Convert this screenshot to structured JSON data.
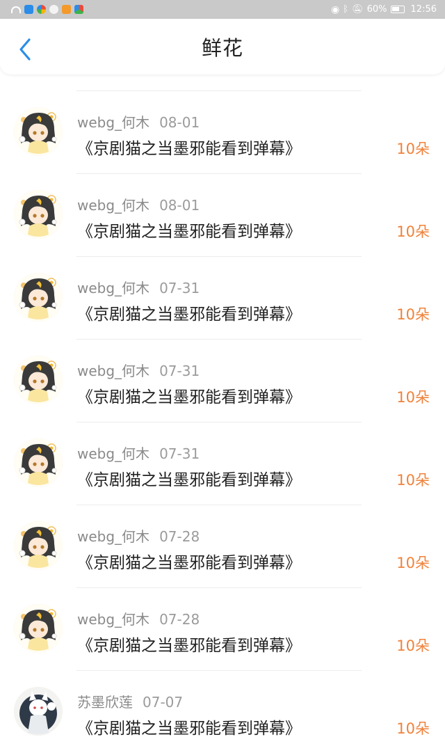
{
  "status_bar": {
    "battery": "60%",
    "time": "12:56"
  },
  "nav": {
    "title": "鲜花"
  },
  "records": [
    {
      "user": "webg_何木",
      "date": "08-01",
      "work": "《京剧猫之当墨邪能看到弹幕》",
      "amount": "10朵",
      "avatar": "girl-avatar"
    },
    {
      "user": "webg_何木",
      "date": "08-01",
      "work": "《京剧猫之当墨邪能看到弹幕》",
      "amount": "10朵",
      "avatar": "girl-avatar"
    },
    {
      "user": "webg_何木",
      "date": "07-31",
      "work": "《京剧猫之当墨邪能看到弹幕》",
      "amount": "10朵",
      "avatar": "girl-avatar"
    },
    {
      "user": "webg_何木",
      "date": "07-31",
      "work": "《京剧猫之当墨邪能看到弹幕》",
      "amount": "10朵",
      "avatar": "girl-avatar"
    },
    {
      "user": "webg_何木",
      "date": "07-31",
      "work": "《京剧猫之当墨邪能看到弹幕》",
      "amount": "10朵",
      "avatar": "girl-avatar"
    },
    {
      "user": "webg_何木",
      "date": "07-28",
      "work": "《京剧猫之当墨邪能看到弹幕》",
      "amount": "10朵",
      "avatar": "girl-avatar"
    },
    {
      "user": "webg_何木",
      "date": "07-28",
      "work": "《京剧猫之当墨邪能看到弹幕》",
      "amount": "10朵",
      "avatar": "girl-avatar"
    },
    {
      "user": "苏墨欣莲",
      "date": "07-07",
      "work": "《京剧猫之当墨邪能看到弹幕》",
      "amount": "10朵",
      "avatar": "cat-avatar"
    }
  ],
  "colors": {
    "accent_blue": "#2b8de8",
    "amount_orange": "#f0823a"
  }
}
